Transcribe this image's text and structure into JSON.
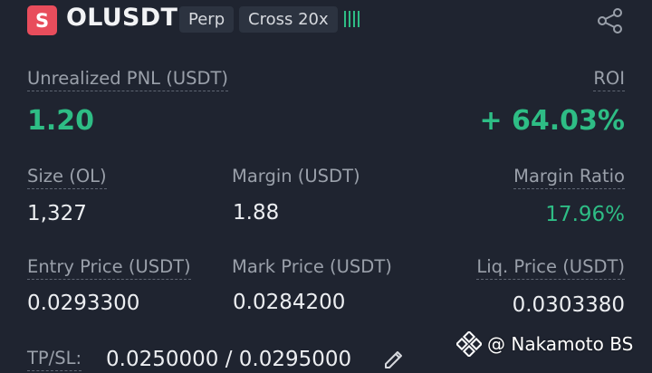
{
  "header": {
    "side_letter": "S",
    "symbol": "OLUSDT",
    "type_tag": "Perp",
    "margin_mode_tag": "Cross 20x",
    "accent_color": "#2ebd85",
    "short_color": "#e84d5c"
  },
  "pnl": {
    "unrealized_label": "Unrealized PNL (USDT)",
    "unrealized_value": "1.20",
    "roi_label": "ROI",
    "roi_value": "+ 64.03%"
  },
  "stats": {
    "size_label": "Size (OL)",
    "size_value": "1,327",
    "margin_label": "Margin (USDT)",
    "margin_value": "1.88",
    "margin_ratio_label": "Margin Ratio",
    "margin_ratio_value": "17.96%",
    "entry_label": "Entry Price (USDT)",
    "entry_value": "0.0293300",
    "mark_label": "Mark Price (USDT)",
    "mark_value": "0.0284200",
    "liq_label": "Liq. Price (USDT)",
    "liq_value": "0.0303380"
  },
  "tpsl": {
    "label": "TP/SL:",
    "value": "0.0250000 / 0.0295000"
  },
  "watermark": {
    "text": "@ Nakamoto BS"
  },
  "icons": {
    "share": "share-icon",
    "edit": "pencil-icon",
    "bars": "signal-bars-icon",
    "logo": "binance-diamond-icon"
  }
}
